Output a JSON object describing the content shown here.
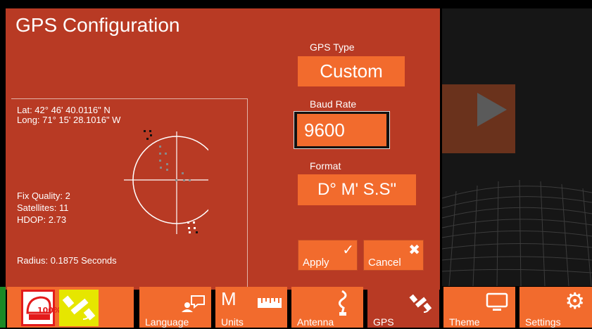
{
  "panel": {
    "title": "GPS Configuration"
  },
  "gps_readout": {
    "lat": "Lat: 42° 46' 40.0116\" N",
    "long": "Long: 71° 15' 28.1016\" W",
    "fix_quality": "Fix Quality: 2",
    "satellites": "Satellites: 11",
    "hdop": "HDOP: 2.73",
    "radius": "Radius: 0.1875 Seconds"
  },
  "fields": {
    "gps_type": {
      "label": "GPS Type",
      "value": "Custom"
    },
    "baud_rate": {
      "label": "Baud Rate",
      "value": "9600"
    },
    "format": {
      "label": "Format",
      "value": "D° M' S.S\""
    }
  },
  "actions": {
    "apply": {
      "label": "Apply",
      "icon": "check-icon"
    },
    "cancel": {
      "label": "Cancel",
      "icon": "close-icon"
    }
  },
  "toolbar": {
    "status_battery": "100%",
    "items": [
      {
        "label": "Language",
        "icon": "language-icon"
      },
      {
        "label": "Units",
        "icon": "units-icon",
        "glyph": "M"
      },
      {
        "label": "Antenna",
        "icon": "antenna-icon"
      },
      {
        "label": "GPS",
        "icon": "satellite-icon",
        "selected": true
      },
      {
        "label": "Theme",
        "icon": "monitor-icon"
      },
      {
        "label": "Settings",
        "icon": "gear-icon"
      }
    ]
  },
  "colors": {
    "panel": "#b83a24",
    "accent": "#f26b2d",
    "background": "#000000"
  }
}
